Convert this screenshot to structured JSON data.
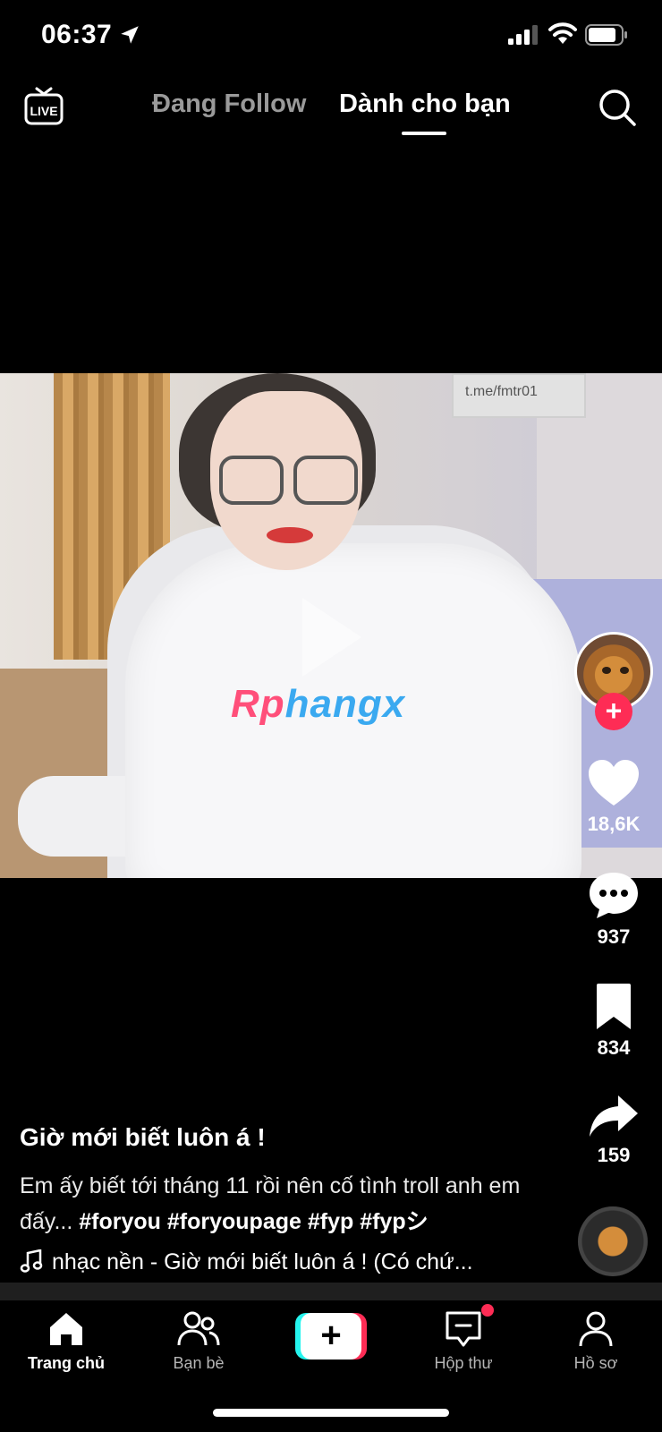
{
  "status_bar": {
    "time": "06:37"
  },
  "top_nav": {
    "live_label": "LIVE",
    "tabs": [
      {
        "label": "Đang Follow",
        "active": false
      },
      {
        "label": "Dành cho bạn",
        "active": true
      }
    ]
  },
  "video": {
    "watermark": "Rphangx",
    "background_sign": "t.me/fmtr01"
  },
  "actions": {
    "likes": "18,6K",
    "comments": "937",
    "saves": "834",
    "shares": "159"
  },
  "caption": {
    "title": "Giờ mới biết luôn á !",
    "description": "Em ấy biết tới tháng 11 rồi nên cố tình troll anh em đấy...",
    "hashtags": "#foryou #foryoupage #fyp #fypシ",
    "music": "nhạc nền - Giờ mới biết luôn á ! (Có chứ..."
  },
  "bottom_nav": {
    "items": [
      {
        "label": "Trang chủ",
        "icon": "home-icon",
        "active": true
      },
      {
        "label": "Bạn bè",
        "icon": "friends-icon",
        "active": false
      },
      {
        "label": "+",
        "icon": "create-icon",
        "active": false
      },
      {
        "label": "Hộp thư",
        "icon": "inbox-icon",
        "active": false
      },
      {
        "label": "Hồ sơ",
        "icon": "profile-icon",
        "active": false
      }
    ]
  },
  "colors": {
    "accent_red": "#fe2c55",
    "accent_cyan": "#25f4ee",
    "inactive_tab": "#9a9a9a"
  }
}
